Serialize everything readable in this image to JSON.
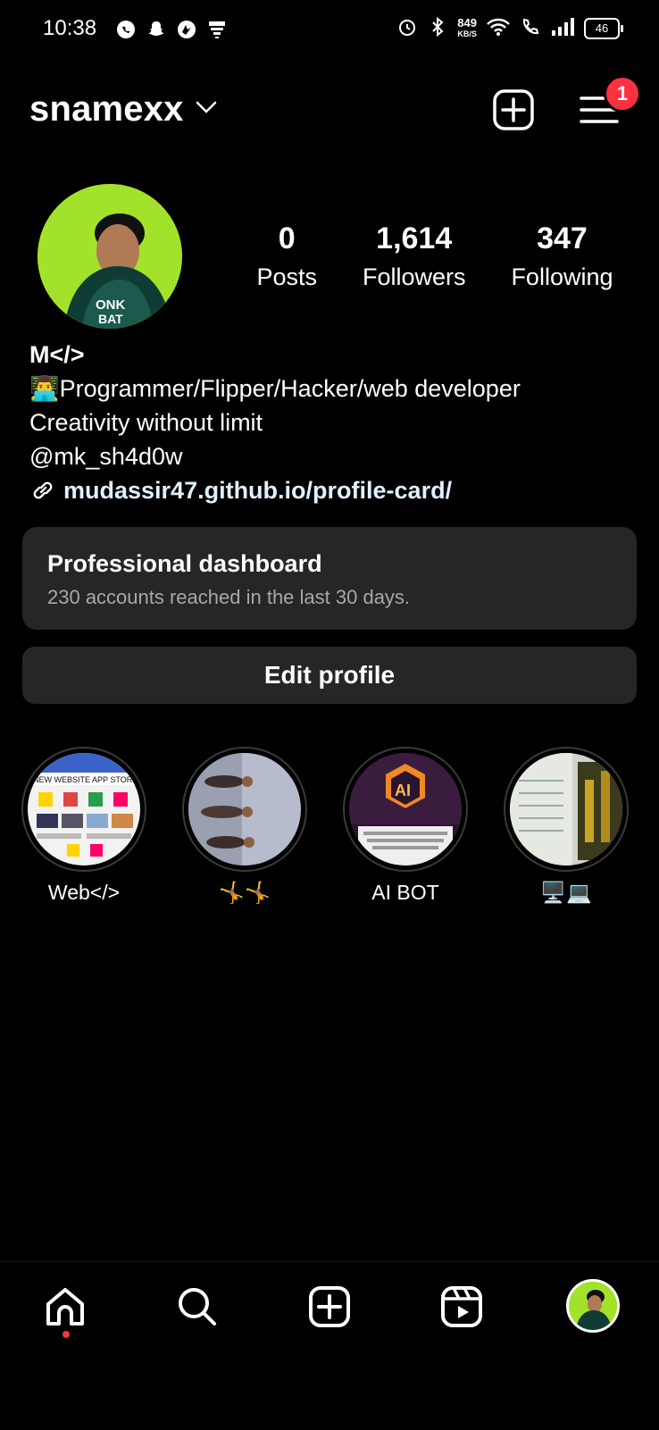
{
  "status_bar": {
    "time": "10:38",
    "net_speed_value": "849",
    "net_speed_unit": "KB/S",
    "battery": "46",
    "icons": [
      "whatsapp-icon",
      "snapchat-icon",
      "browser-icon",
      "screen-icon",
      "alarm-icon",
      "bluetooth-icon",
      "wifi-icon",
      "call-icon",
      "signal-icon"
    ]
  },
  "header": {
    "username": "snamexx",
    "notification_count": "1"
  },
  "profile": {
    "stats": [
      {
        "value": "0",
        "label": "Posts"
      },
      {
        "value": "1,614",
        "label": "Followers"
      },
      {
        "value": "347",
        "label": "Following"
      }
    ],
    "bio": {
      "name": "M</>",
      "line1": "👨‍💻Programmer/Flipper/Hacker/web developer",
      "line2": "Creativity without limit",
      "line3": "@mk_sh4d0w",
      "link": "mudassir47.github.io/profile-card/"
    }
  },
  "dashboard": {
    "title": "Professional dashboard",
    "subtitle": "230 accounts reached in the last 30 days."
  },
  "edit_profile_label": "Edit profile",
  "highlights": [
    {
      "label": "Web</>"
    },
    {
      "label": "🤸🤸"
    },
    {
      "label": "AI BOT"
    },
    {
      "label": "🖥️💻"
    }
  ],
  "colors": {
    "background": "#000000",
    "card": "#262626",
    "badge": "#ff3040",
    "avatar_bg": "#9be21a"
  },
  "bottom_nav": [
    "home-icon",
    "search-icon",
    "create-icon",
    "reels-icon",
    "profile-avatar"
  ]
}
